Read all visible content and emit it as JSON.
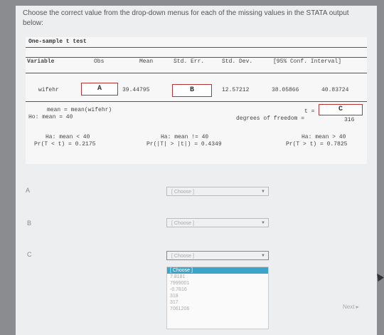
{
  "question": "Choose the correct value from the drop-down menus for each of the missing values in the STATA output below:",
  "stata": {
    "title": "One-sample t test",
    "headers": {
      "variable": "Variable",
      "obs": "Obs",
      "mean": "Mean",
      "std_err": "Std. Err.",
      "std_dev": "Std. Dev.",
      "conf": "[95% Conf. Interval]"
    },
    "row": {
      "variable": "wifehr",
      "obs_box": "A",
      "mean": "39.44795",
      "std_err_box": "B",
      "std_dev": "12.57212",
      "ci_low": "38.05866",
      "ci_high": "40.83724"
    },
    "mean_def": "mean = mean(wifehr)",
    "h0": "Ho: mean = 40",
    "t_label": "t =",
    "t_box": "C",
    "df_label": "degrees of freedom =",
    "df_value": "316",
    "ha_left": "Ha: mean < 40",
    "p_left": "Pr(T < t) = 0.2175",
    "ha_mid": "Ha: mean != 40",
    "p_mid": "Pr(|T| > |t|) = 0.4349",
    "ha_right": "Ha: mean > 40",
    "p_right": "Pr(T > t) = 0.7825"
  },
  "answers": {
    "a_label": "A",
    "b_label": "B",
    "c_label": "C",
    "a_select": "[ Choose ]",
    "b_select": "[ Choose ]",
    "c_select": "[ Choose ]"
  },
  "dropdown_options": [
    "[ Choose ]",
    "7.8181",
    "7999001",
    "-0.7816",
    "318",
    "317",
    "7061206"
  ],
  "next_label": "Next ▸",
  "colors": {
    "highlight": "#3aa5c9",
    "box_border": "#b33"
  }
}
